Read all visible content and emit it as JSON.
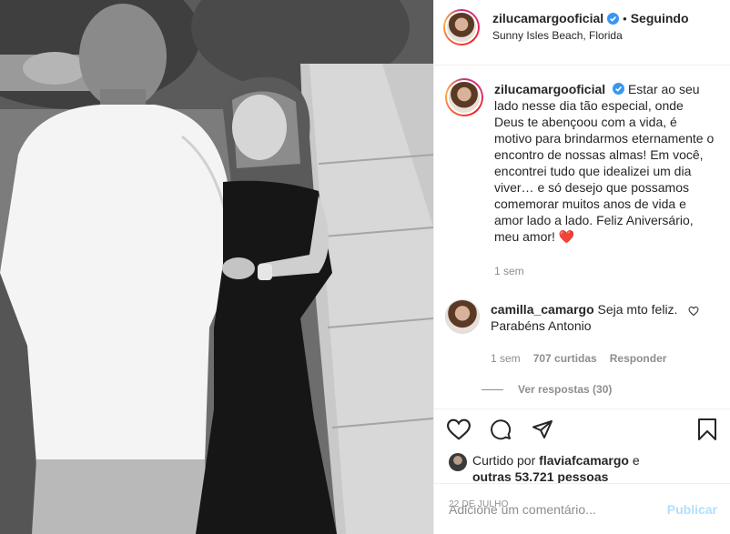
{
  "post": {
    "username": "zilucamargooficial",
    "follow_status": "Seguindo",
    "separator": "•",
    "location": "Sunny Isles Beach, Florida"
  },
  "caption": {
    "username": "zilucamargooficial",
    "text": "Estar ao seu lado nesse dia tão especial, onde Deus te abençoou com a vida, é motivo para brindarmos eternamente o encontro de nossas almas! Em você, encontrei tudo que idealizei um dia viver… e só desejo que possamos comemorar muitos anos de vida e amor lado a lado. Feliz Aniversário, meu amor! ",
    "emoji": "❤️",
    "time": "1 sem"
  },
  "comment": {
    "username": "camilla_camargo",
    "text": "Seja mto feliz. Parabéns Antonio",
    "time": "1 sem",
    "likes": "707 curtidas",
    "reply_label": "Responder",
    "view_replies": "Ver respostas (30)"
  },
  "liked_by": {
    "prefix": "Curtido por",
    "user": "flaviafcamargo",
    "connector": "e",
    "others": "outras 53.721 pessoas"
  },
  "date": "22 DE JULHO",
  "add_comment": {
    "placeholder": "Adicione um comentário...",
    "publish": "Publicar"
  },
  "icons": {
    "verified": "verified-badge-icon",
    "like": "heart-icon",
    "comment": "comment-bubble-icon",
    "share": "paper-plane-icon",
    "save": "bookmark-icon",
    "comment_like": "small-heart-icon"
  },
  "colors": {
    "verified": "#3897f0",
    "text": "#262626",
    "muted": "#8e8e8e",
    "publish_disabled": "#b2dffc",
    "heart_emoji": "#ed4956"
  }
}
